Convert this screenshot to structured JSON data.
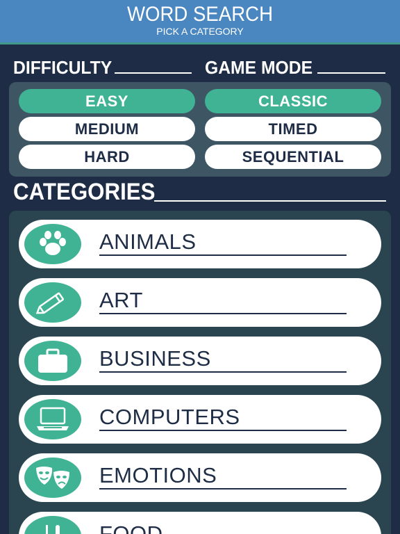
{
  "header": {
    "title": "WORD SEARCH",
    "subtitle": "PICK A CATEGORY"
  },
  "difficulty": {
    "label": "DIFFICULTY",
    "options": [
      "EASY",
      "MEDIUM",
      "HARD"
    ],
    "selected": "EASY"
  },
  "game_mode": {
    "label": "GAME MODE",
    "options": [
      "CLASSIC",
      "TIMED",
      "SEQUENTIAL"
    ],
    "selected": "CLASSIC"
  },
  "categories": {
    "label": "CATEGORIES",
    "items": [
      {
        "label": "ANIMALS",
        "icon": "paw-icon"
      },
      {
        "label": "ART",
        "icon": "pencil-icon"
      },
      {
        "label": "BUSINESS",
        "icon": "briefcase-icon"
      },
      {
        "label": "COMPUTERS",
        "icon": "laptop-icon"
      },
      {
        "label": "EMOTIONS",
        "icon": "theater-masks-icon"
      },
      {
        "label": "FOOD",
        "icon": "utensils-icon"
      }
    ]
  },
  "colors": {
    "background": "#1e2d45",
    "header": "#4a86c0",
    "accent": "#3fb394",
    "panel": "#3e5563",
    "category_panel": "#2b4550"
  }
}
